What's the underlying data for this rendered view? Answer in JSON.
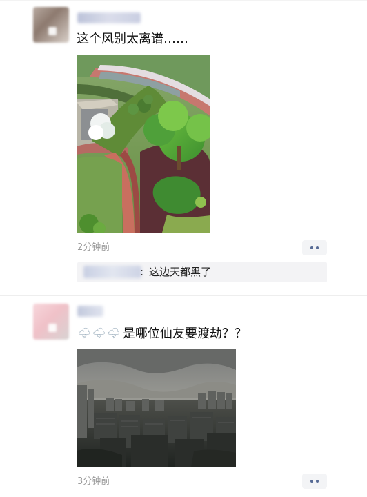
{
  "posts": [
    {
      "text": "这个风别太离谱……",
      "time": "2分钟前",
      "comment": {
        "text": "这边天都黑了"
      }
    },
    {
      "weather_icons": "🌩🌩🌩",
      "text": "是哪位仙友要渡劫？？",
      "time": "3分钟前"
    }
  ],
  "icons": {
    "more": "more-icon",
    "weather": "thunder-cloud-icon"
  }
}
